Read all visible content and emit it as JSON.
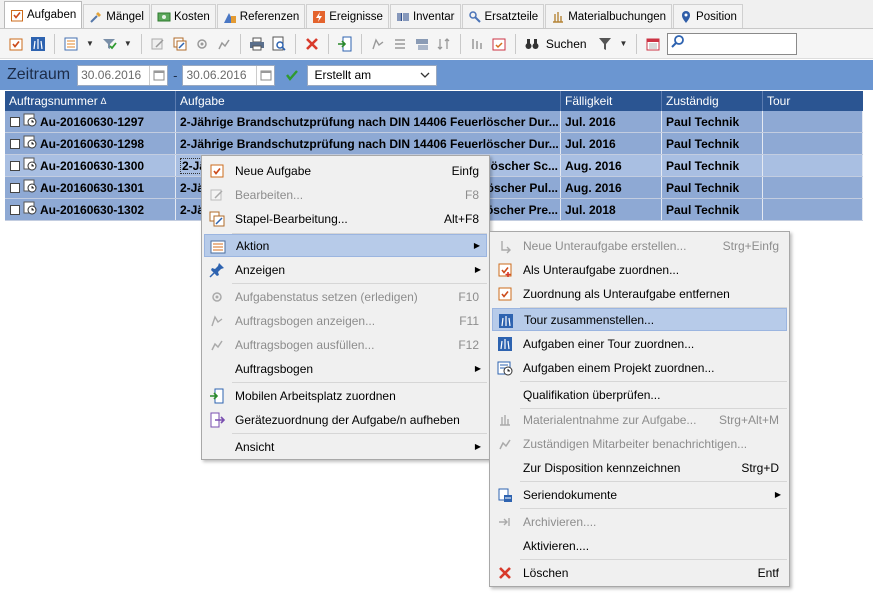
{
  "tabs": [
    {
      "label": "Aufgaben",
      "icon": "task-check-icon"
    },
    {
      "label": "Mängel",
      "icon": "tools-icon"
    },
    {
      "label": "Kosten",
      "icon": "money-icon"
    },
    {
      "label": "Referenzen",
      "icon": "building-icon"
    },
    {
      "label": "Ereignisse",
      "icon": "lightning-icon"
    },
    {
      "label": "Inventar",
      "icon": "barcode-icon"
    },
    {
      "label": "Ersatzteile",
      "icon": "parts-icon"
    },
    {
      "label": "Materialbuchungen",
      "icon": "material-icon"
    },
    {
      "label": "Position",
      "icon": "location-pin-icon"
    }
  ],
  "toolbar": {
    "search_label": "Suchen",
    "search_value": ""
  },
  "filter": {
    "zeitraum_label": "Zeitraum",
    "date_from": "30.06.2016",
    "date_sep": "-",
    "date_to": "30.06.2016",
    "date_field": "Erstellt am"
  },
  "grid": {
    "headers": [
      "Auftragsnummer",
      "Aufgabe",
      "Fälligkeit",
      "Zuständig",
      "Tour"
    ],
    "sort_indicator": "∆",
    "rows": [
      {
        "nr": "Au-20160630-1297",
        "aufgabe": "2-Jährige Brandschutzprüfung nach DIN 14406 Feuerlöscher Dur...",
        "faellig": "Jul. 2016",
        "zustaendig": "Paul Technik",
        "tour": ""
      },
      {
        "nr": "Au-20160630-1298",
        "aufgabe": "2-Jährige Brandschutzprüfung nach DIN 14406 Feuerlöscher Dur...",
        "faellig": "Jul. 2016",
        "zustaendig": "Paul Technik",
        "tour": ""
      },
      {
        "nr": "Au-20160630-1300",
        "aufgabe": "2-Jä",
        "aufgabe_tail": "öscher Sc...",
        "faellig": "Aug. 2016",
        "zustaendig": "Paul Technik",
        "tour": ""
      },
      {
        "nr": "Au-20160630-1301",
        "aufgabe": "2-Jä",
        "aufgabe_tail": "öscher Pul...",
        "faellig": "Aug. 2016",
        "zustaendig": "Paul Technik",
        "tour": ""
      },
      {
        "nr": "Au-20160630-1302",
        "aufgabe": "2-Jä",
        "aufgabe_tail": "öscher Pre...",
        "faellig": "Jul. 2018",
        "zustaendig": "Paul Technik",
        "tour": ""
      }
    ]
  },
  "context_menu": [
    {
      "label": "Neue Aufgabe",
      "shortcut": "Einfg",
      "enabled": true,
      "icon": "new-task-icon"
    },
    {
      "label": "Bearbeiten...",
      "shortcut": "F8",
      "enabled": false,
      "icon": "edit-icon"
    },
    {
      "label": "Stapel-Bearbeitung...",
      "shortcut": "Alt+F8",
      "enabled": true,
      "icon": "batch-edit-icon"
    },
    {
      "label": "Aktion",
      "submenu": true,
      "enabled": true,
      "icon": "action-icon"
    },
    {
      "label": "Anzeigen",
      "submenu": true,
      "enabled": true,
      "icon": "pin-icon"
    },
    {
      "label": "Aufgabenstatus setzen (erledigen)",
      "shortcut": "F10",
      "enabled": false,
      "icon": "status-icon"
    },
    {
      "label": "Auftragsbogen anzeigen...",
      "shortcut": "F11",
      "enabled": false,
      "icon": "form-view-icon"
    },
    {
      "label": "Auftragsbogen ausfüllen...",
      "shortcut": "F12",
      "enabled": false,
      "icon": "form-fill-icon"
    },
    {
      "label": "Auftragsbogen",
      "submenu": true,
      "enabled": true,
      "icon": ""
    },
    {
      "label": "Mobilen Arbeitsplatz zuordnen",
      "enabled": true,
      "icon": "assign-mobile-icon"
    },
    {
      "label": "Gerätezuordnung der Aufgabe/n aufheben",
      "enabled": true,
      "icon": "unassign-device-icon"
    },
    {
      "label": "Ansicht",
      "submenu": true,
      "enabled": true,
      "icon": ""
    }
  ],
  "submenu": [
    {
      "label": "Neue Unteraufgabe erstellen...",
      "shortcut": "Strg+Einfg",
      "enabled": false,
      "icon": "new-subtask-icon"
    },
    {
      "label": "Als Unteraufgabe zuordnen...",
      "enabled": true,
      "icon": "assign-subtask-icon"
    },
    {
      "label": "Zuordnung als Unteraufgabe entfernen",
      "enabled": true,
      "icon": "remove-subtask-icon"
    },
    {
      "label": "Tour zusammenstellen...",
      "enabled": true,
      "highlighted": true,
      "icon": "route-icon"
    },
    {
      "label": "Aufgaben einer Tour zuordnen...",
      "enabled": true,
      "icon": "route-assign-icon"
    },
    {
      "label": "Aufgaben einem Projekt zuordnen...",
      "enabled": true,
      "icon": "project-icon"
    },
    {
      "label": "Qualifikation überprüfen...",
      "enabled": true,
      "icon": ""
    },
    {
      "label": "Materialentnahme zur Aufgabe...",
      "shortcut": "Strg+Alt+M",
      "enabled": false,
      "icon": "material-take-icon"
    },
    {
      "label": "Zuständigen Mitarbeiter benachrichtigen...",
      "enabled": false,
      "icon": "notify-icon"
    },
    {
      "label": "Zur Disposition kennzeichnen",
      "shortcut": "Strg+D",
      "enabled": true,
      "icon": ""
    },
    {
      "label": "Seriendokumente",
      "submenu": true,
      "enabled": true,
      "icon": "serial-docs-icon"
    },
    {
      "label": "Archivieren....",
      "enabled": false,
      "icon": "archive-icon"
    },
    {
      "label": "Aktivieren....",
      "enabled": true,
      "icon": ""
    },
    {
      "label": "Löschen",
      "shortcut": "Entf",
      "enabled": true,
      "icon": "delete-icon"
    }
  ],
  "colors": {
    "header_blue": "#2b5592",
    "filter_blue": "#6b96d1",
    "row_selected": "#8ea9d4",
    "highlight": "#b7cbe9",
    "delete_red": "#d83a2b"
  }
}
